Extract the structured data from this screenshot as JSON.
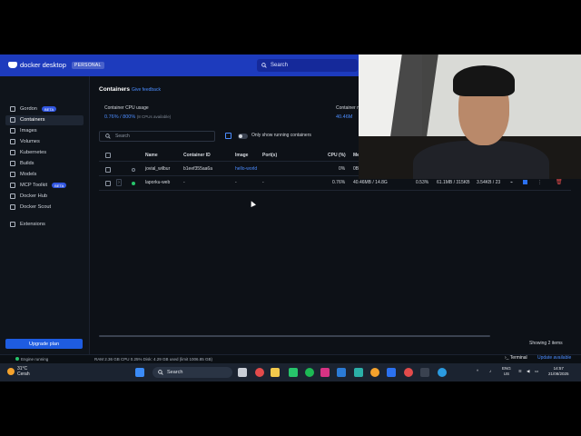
{
  "app": {
    "brand": "docker desktop",
    "plan_badge": "PERSONAL",
    "search_placeholder": "Search"
  },
  "sidebar": {
    "items": [
      {
        "label": "Gordon",
        "icon": "sparkle-icon",
        "badge": "BETA"
      },
      {
        "label": "Containers",
        "icon": "containers-icon",
        "active": true
      },
      {
        "label": "Images",
        "icon": "images-icon"
      },
      {
        "label": "Volumes",
        "icon": "volumes-icon"
      },
      {
        "label": "Kubernetes",
        "icon": "kubernetes-icon"
      },
      {
        "label": "Builds",
        "icon": "builds-icon"
      },
      {
        "label": "Models",
        "icon": "models-icon"
      },
      {
        "label": "MCP Toolkit",
        "icon": "mcp-icon",
        "badge": "BETA"
      },
      {
        "label": "Docker Hub",
        "icon": "hub-icon"
      },
      {
        "label": "Docker Scout",
        "icon": "scout-icon"
      },
      {
        "label": "Extensions",
        "icon": "extensions-icon"
      }
    ],
    "upgrade_label": "Upgrade plan"
  },
  "main": {
    "title": "Containers",
    "feedback": "Give feedback",
    "cpu_label": "Container CPU usage",
    "cpu_value": "0.76% / 800%",
    "cpu_note": "(8 CPUs available)",
    "mem_label": "Container m",
    "mem_value": "40.46M",
    "search_placeholder": "Search",
    "toggle_label": "Only show running containers",
    "columns": [
      "Name",
      "Container ID",
      "Image",
      "Port(s)",
      "CPU (%)",
      "Me"
    ],
    "rows": [
      {
        "name": "jovial_wilbur",
        "id": "b1eef355aa6a",
        "image": "hello-world",
        "ports": "",
        "cpu": "0%",
        "mem": "0B",
        "running": false
      },
      {
        "name": "laporku-web",
        "id": "-",
        "image": "-",
        "ports": "-",
        "cpu": "0.76%",
        "mem": "40.46MB / 14.8G",
        "cpu2": "0.53%",
        "net": "61.1MB / 315KB",
        "disk": "3.54KB / 23",
        "running": true
      }
    ],
    "showing": "Showing 2 items"
  },
  "statusbar": {
    "engine": "Engine running",
    "stats": "RAM 2.36 GB   CPU 0.25%   Disk: 4.29 GB used (limit 1006.85 GB)",
    "terminal": "Terminal",
    "update": "Update available"
  },
  "taskbar": {
    "temp": "31°C",
    "weather": "Cerah",
    "search": "Search",
    "lang": "ENG",
    "region": "US",
    "time": "14:57",
    "date": "21/08/2025"
  }
}
